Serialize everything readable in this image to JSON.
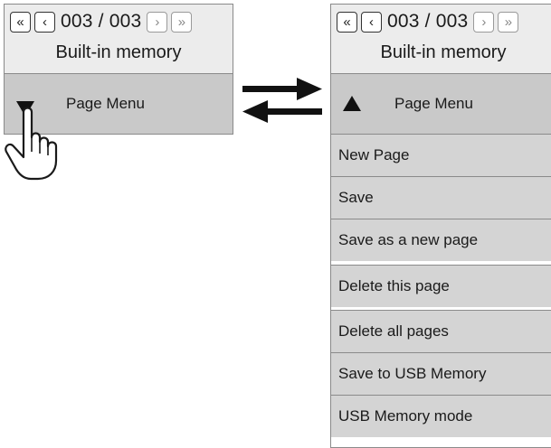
{
  "before": {
    "pager": {
      "page_count": "003 / 003"
    },
    "memory_label": "Built-in memory",
    "menu_title": "Page Menu"
  },
  "after": {
    "pager": {
      "page_count": "003 / 003"
    },
    "memory_label": "Built-in memory",
    "menu_title": "Page Menu",
    "items": [
      {
        "label": "New Page"
      },
      {
        "label": "Save"
      },
      {
        "label": "Save as a new page"
      },
      {
        "label": "Delete this page"
      },
      {
        "label": "Delete all pages"
      },
      {
        "label": "Save to USB Memory"
      },
      {
        "label": "USB Memory mode"
      }
    ]
  },
  "icons": {
    "first_page": "double-chevron-left-icon",
    "prev_page": "chevron-left-icon",
    "next_page": "chevron-right-icon",
    "last_page": "double-chevron-right-icon",
    "menu_collapsed": "triangle-down-icon",
    "menu_expanded": "triangle-up-icon",
    "transition": "bidirectional-arrows-icon",
    "pointer": "hand-pointer-icon"
  }
}
